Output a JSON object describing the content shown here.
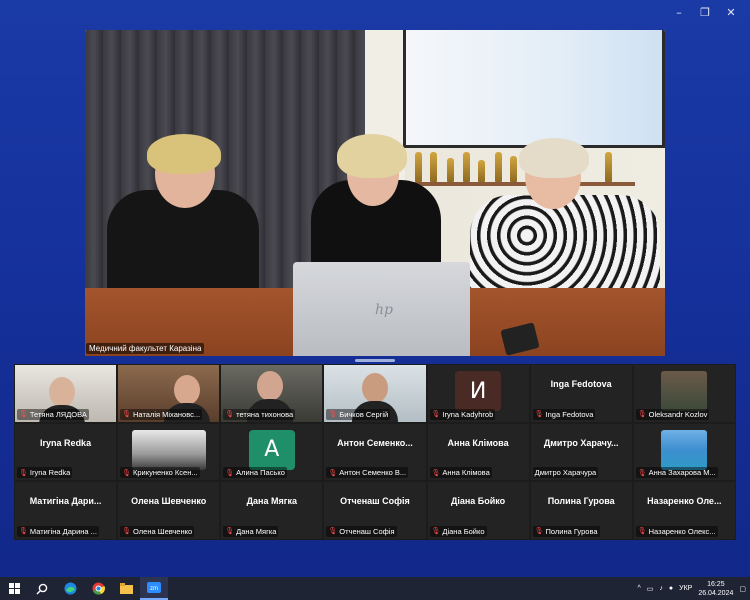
{
  "window": {
    "controls": [
      "–",
      "❐",
      "✕"
    ]
  },
  "speaker": {
    "name": "Медичний факультет Каразіна"
  },
  "colors": {
    "background": "#16308f",
    "gallery": "#1c1c1c",
    "muted_icon": "#ff4a4a",
    "taskbar": "#1f2435"
  },
  "gallery": {
    "tiles": [
      {
        "name": "Тетяна ЛЯДОВА",
        "type": "video",
        "muted": true
      },
      {
        "name": "Наталія Міхановс...",
        "type": "video",
        "muted": true
      },
      {
        "name": "тетяна тихонова",
        "type": "video",
        "muted": true
      },
      {
        "name": "Бичков Сергій",
        "type": "video",
        "muted": true
      },
      {
        "name": "Iryna Kadyhrob",
        "type": "letter",
        "letter": "И",
        "avatar_color": "#4a2a24",
        "muted": true
      },
      {
        "name": "Inga Fedotova",
        "type": "text",
        "center": "Inga Fedotova",
        "muted": true
      },
      {
        "name": "Oleksandr Kozlov",
        "type": "photo",
        "muted": true
      },
      {
        "name": "Iryna Redka",
        "type": "text",
        "center": "Iryna Redka",
        "muted": true
      },
      {
        "name": "Крикуненко Ксен...",
        "type": "photo_bw",
        "muted": true
      },
      {
        "name": "Алина Пасько",
        "type": "letter",
        "letter": "А",
        "avatar_color": "#1f8f6a",
        "muted": true
      },
      {
        "name": "Антон Семенко В...",
        "type": "text",
        "center": "Антон  Семенко...",
        "muted": true
      },
      {
        "name": "Анна Клімова",
        "type": "text",
        "center": "Анна Клімова",
        "muted": true
      },
      {
        "name": "Дмитро Харачура",
        "type": "text",
        "center": "Дмитро  Харачу...",
        "muted": false
      },
      {
        "name": "Анна Захарова М...",
        "type": "photo_pool",
        "muted": true
      },
      {
        "name": "Матигіна Дарина ...",
        "type": "text",
        "center": "Матигіна  Дари...",
        "muted": true
      },
      {
        "name": "Олена Шевченко",
        "type": "text",
        "center": "Олена Шевченко",
        "muted": true
      },
      {
        "name": "Дана Мягка",
        "type": "text",
        "center": "Дана Мягка",
        "muted": true
      },
      {
        "name": "Отченаш Софія",
        "type": "text",
        "center": "Отченаш Софія",
        "muted": true
      },
      {
        "name": "Діана Бойко",
        "type": "text",
        "center": "Діана Бойко",
        "muted": true
      },
      {
        "name": "Полина Гурова",
        "type": "text",
        "center": "Полина Гурова",
        "muted": true
      },
      {
        "name": "Назаренко Олекс...",
        "type": "text",
        "center": "Назаренко  Оле...",
        "muted": true
      }
    ]
  },
  "taskbar": {
    "start_icon": "windows-start-icon",
    "search_icon": "search-icon",
    "language": "УКР",
    "time": "16:25",
    "date": "26.04.2024"
  }
}
